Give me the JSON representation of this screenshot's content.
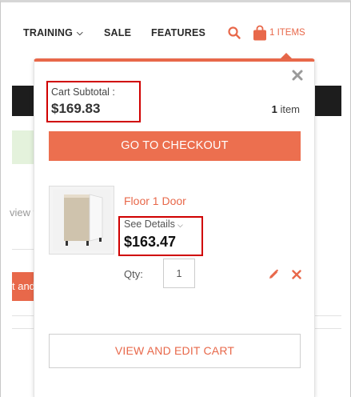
{
  "nav": {
    "items": [
      {
        "label": "TRAINING",
        "has_dropdown": true
      },
      {
        "label": "SALE"
      },
      {
        "label": "FEATURES"
      }
    ],
    "search_icon": "search-icon",
    "cart_icon": "shopping-bag-icon",
    "cart_count_label": "1 ITEMS"
  },
  "background": {
    "partial_text": "view t",
    "partial_button": "t and"
  },
  "minicart": {
    "close_icon": "close-icon",
    "subtotal_label": "Cart Subtotal :",
    "subtotal_value": "$169.83",
    "item_count_number": "1",
    "item_count_word": "item",
    "checkout_label": "GO TO CHECKOUT",
    "product": {
      "name": "Floor 1 Door",
      "see_details_label": "See Details",
      "price": "$163.47",
      "qty_label": "Qty:",
      "qty_value": "1"
    },
    "view_cart_label": "VIEW AND EDIT CART"
  },
  "colors": {
    "accent": "#e8684a",
    "highlight_box": "#d00000",
    "dark_bar": "#1d1d1d"
  }
}
